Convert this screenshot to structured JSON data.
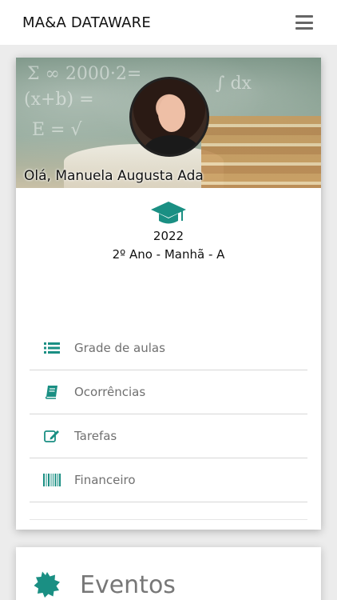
{
  "header": {
    "brand": "MA&A DATAWARE",
    "menu_icon": "hamburger-menu-icon"
  },
  "profile": {
    "greeting": "Olá, Manuela Augusta Ada",
    "year": "2022",
    "class": "2º Ano - Manhã - A",
    "icon": "graduation-cap-icon"
  },
  "menu": {
    "items": [
      {
        "label": "Grade de aulas",
        "icon": "list-icon"
      },
      {
        "label": "Ocorrências",
        "icon": "book-icon"
      },
      {
        "label": "Tarefas",
        "icon": "edit-icon"
      },
      {
        "label": "Financeiro",
        "icon": "barcode-icon"
      }
    ]
  },
  "events": {
    "title": "Eventos",
    "icon": "badge-icon"
  },
  "colors": {
    "accent": "#1a8f83",
    "text_muted": "#707070"
  }
}
